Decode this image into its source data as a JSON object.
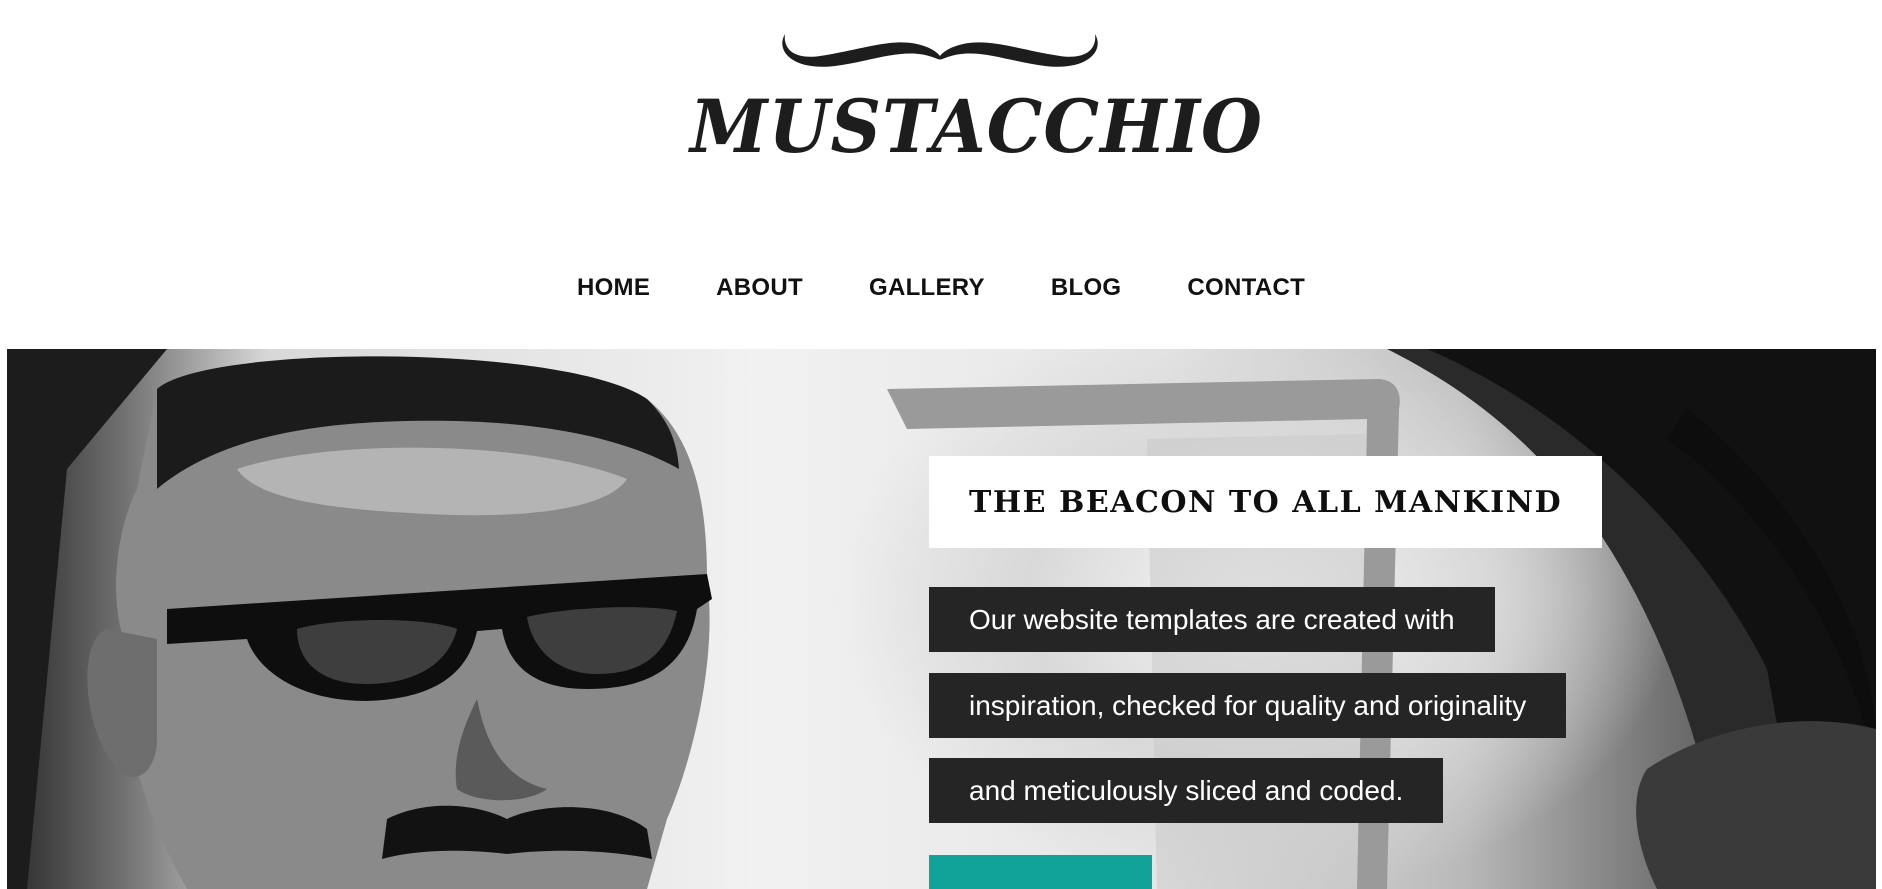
{
  "brand": {
    "logo_text": "MUSTACCHIO",
    "logo_icon": "mustache-icon"
  },
  "nav": {
    "items": [
      {
        "label": "HOME"
      },
      {
        "label": "ABOUT"
      },
      {
        "label": "GALLERY"
      },
      {
        "label": "BLOG"
      },
      {
        "label": "CONTACT"
      }
    ]
  },
  "hero": {
    "image": "man-with-mustache-in-car-photo",
    "headline": "THE BEACON TO ALL MANKIND",
    "body_lines": [
      "Our website templates are created with",
      "inspiration, checked for quality and originality",
      "and meticulously sliced and coded."
    ],
    "cta_color": "#10a39a"
  },
  "colors": {
    "text_box_bg": "#252525",
    "headline_box_bg": "#ffffff",
    "accent": "#10a39a"
  }
}
